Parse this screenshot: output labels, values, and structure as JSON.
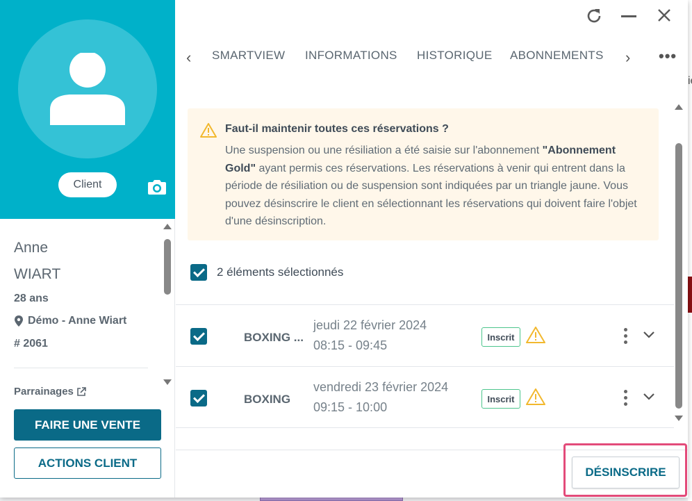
{
  "colors": {
    "accent": "#0a6a87",
    "profile_bg": "#00b1c9",
    "warning_bg": "#fff7ea",
    "warning_icon": "#f2b82e",
    "status_border": "#4cc58c",
    "highlight": "#e34b7a"
  },
  "profile": {
    "badge": "Client",
    "first_name": "Anne",
    "last_name": "WIART",
    "age": "28 ans",
    "location": "Démo - Anne Wiart",
    "member_id": "# 2061",
    "parrainages": "Parrainages",
    "icons": {
      "avatar": "user-icon",
      "camera": "camera-icon",
      "location": "map-pin-icon",
      "external": "external-link-icon"
    }
  },
  "left_actions": {
    "sale": "FAIRE UNE VENTE",
    "actions": "ACTIONS CLIENT"
  },
  "tabs": {
    "items": [
      {
        "label": "SMARTVIEW"
      },
      {
        "label": "INFORMATIONS"
      },
      {
        "label": "HISTORIQUE"
      },
      {
        "label": "ABONNEMENTS"
      }
    ]
  },
  "warning": {
    "title": "Faut-il maintenir toutes ces réservations ?",
    "text_before": "Une suspension ou une résiliation a été saisie sur l'abonnement ",
    "subscription": "\"Abonnement Gold\"",
    "text_after": " ayant permis ces réservations. Les réservations à venir qui entrent dans la période de résiliation ou de suspension sont indiquées par un triangle jaune. Vous pouvez désinscrire le client en sélectionnant les réservations qui doivent faire l'objet d'une désinscription."
  },
  "selection": {
    "label": "2 éléments sélectionnés"
  },
  "reservations": [
    {
      "name": "BOXING ...",
      "date": "jeudi 22 février 2024",
      "time": "08:15 - 09:45",
      "status": "Inscrit"
    },
    {
      "name": "BOXING",
      "date": "vendredi 23 février 2024",
      "time": "09:15 - 10:00",
      "status": "Inscrit"
    }
  ],
  "footer": {
    "unsubscribe": "DÉSINSCRIRE"
  }
}
